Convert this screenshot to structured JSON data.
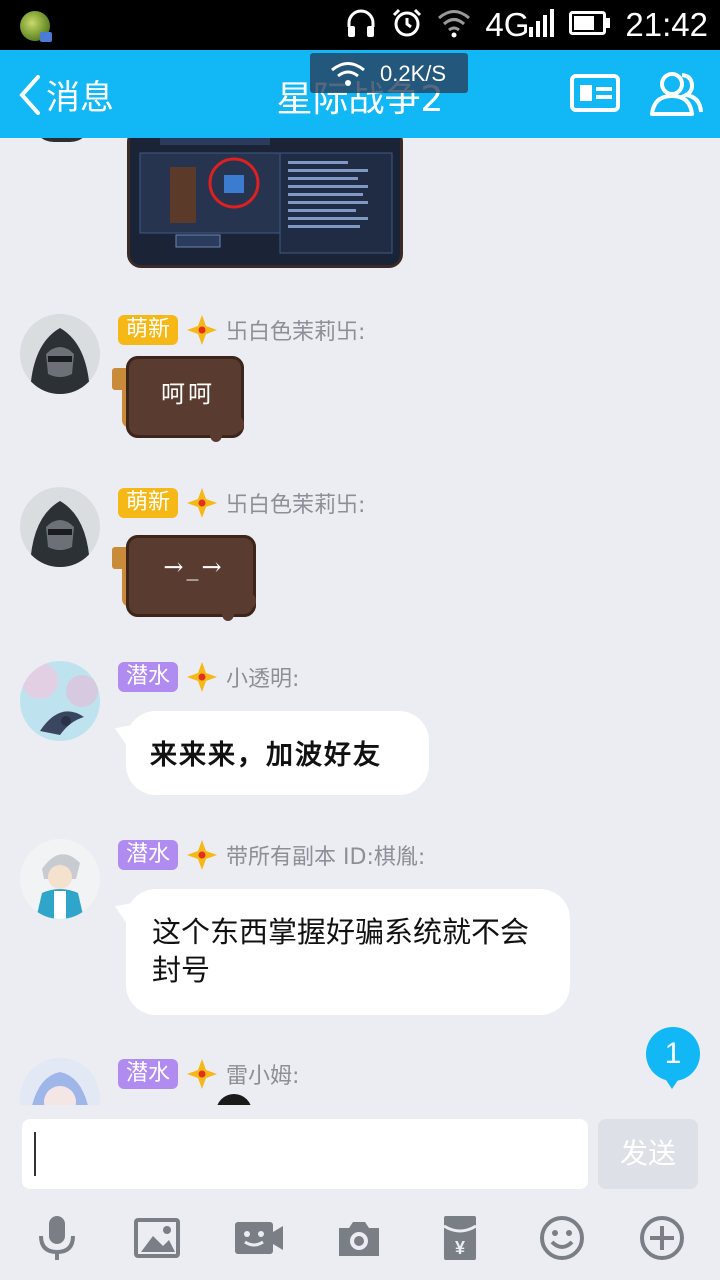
{
  "status_bar": {
    "network": "4G",
    "time": "21:42",
    "net_speed": "0.2K/S"
  },
  "header": {
    "back_label": "消息",
    "title": "星际战争2"
  },
  "messages": [
    {
      "badge": "萌新",
      "sender": "卐白色茉莉卐:",
      "sticker_text": "呵呵"
    },
    {
      "badge": "萌新",
      "sender": "卐白色茉莉卐:",
      "sticker_text": "→_→"
    },
    {
      "badge": "潜水",
      "sender": "小透明:",
      "text": "来来来，加波好友"
    },
    {
      "badge": "潜水",
      "sender": "带所有副本 ID:棋胤:",
      "text": "这个东西掌握好骗系统就不会封号"
    },
    {
      "badge": "潜水",
      "sender": "雷小姆:"
    }
  ],
  "unread_count": "1",
  "input": {
    "value": "",
    "send_label": "发送"
  },
  "colors": {
    "header": "#12b7f5",
    "badge_newbie": "#f5b817",
    "badge_lurker": "#b08cf0",
    "background": "#ebedf2"
  },
  "toolbar_icons": [
    "microphone-icon",
    "image-icon",
    "video-call-icon",
    "camera-icon",
    "red-packet-icon",
    "emoji-icon",
    "plus-icon"
  ]
}
